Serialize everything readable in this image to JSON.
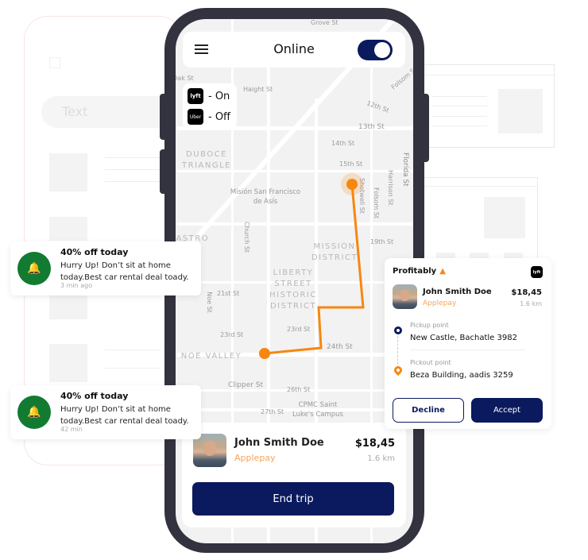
{
  "background": {
    "search_placeholder": "Text"
  },
  "header": {
    "title": "Online",
    "menu_icon": "hamburger-icon",
    "toggle_on": true
  },
  "platforms": [
    {
      "name": "lyft",
      "logo_text": "lyft",
      "status": "- On"
    },
    {
      "name": "uber",
      "logo_text": "Uber",
      "status": "- Off"
    }
  ],
  "map": {
    "labels": [
      "Grove St",
      "Oak St",
      "Haight St",
      "Folsom St",
      "12th St",
      "13th St",
      "14th St",
      "15th St",
      "Shotwell St",
      "Folsom St",
      "Harrison St",
      "Florida St",
      "Church St",
      "19th St",
      "21st St",
      "Noe St",
      "23rd St",
      "23rd St",
      "24th St",
      "Clipper St",
      "26th St",
      "27th St"
    ],
    "districts": [
      "DUBOCE TRIANGLE",
      "Misión San Francisco de Asís",
      "CASTRO",
      "MISSION DISTRICT",
      "LIBERTY STREET HISTORIC DISTRICT",
      "NOE VALLEY",
      "CPMC Saint Luke's Campus"
    ],
    "route_color": "#f7870f"
  },
  "trip": {
    "name": "John Smith Doe",
    "payment": "Applepay",
    "price": "$18,45",
    "distance": "1.6 km",
    "end_label": "End trip"
  },
  "notifications": [
    {
      "title": "40% off today",
      "body": "Hurry Up! Don’t sit at home today.Best car rental deal toady.",
      "time": "3 min ago",
      "icon": "bell-icon"
    },
    {
      "title": "40% off today",
      "body": "Hurry Up! Don’t sit at home today.Best car rental deal toady.",
      "time": "42 min",
      "icon": "bell-icon"
    }
  ],
  "request": {
    "badge": "Profitably",
    "name": "John Smith Doe",
    "payment": "Applepay",
    "price": "$18,45",
    "distance": "1.6 km",
    "pickup_label": "Pickup point",
    "pickup": "New Castle, Bachatle 3982",
    "dropoff_label": "Pickout point",
    "dropoff": "Beza Building, aadis 3259",
    "decline": "Decline",
    "accept": "Accept"
  },
  "colors": {
    "navy": "#0b1a5e",
    "orange": "#f7870f",
    "green": "#137a32",
    "payment": "#f5a55a"
  }
}
